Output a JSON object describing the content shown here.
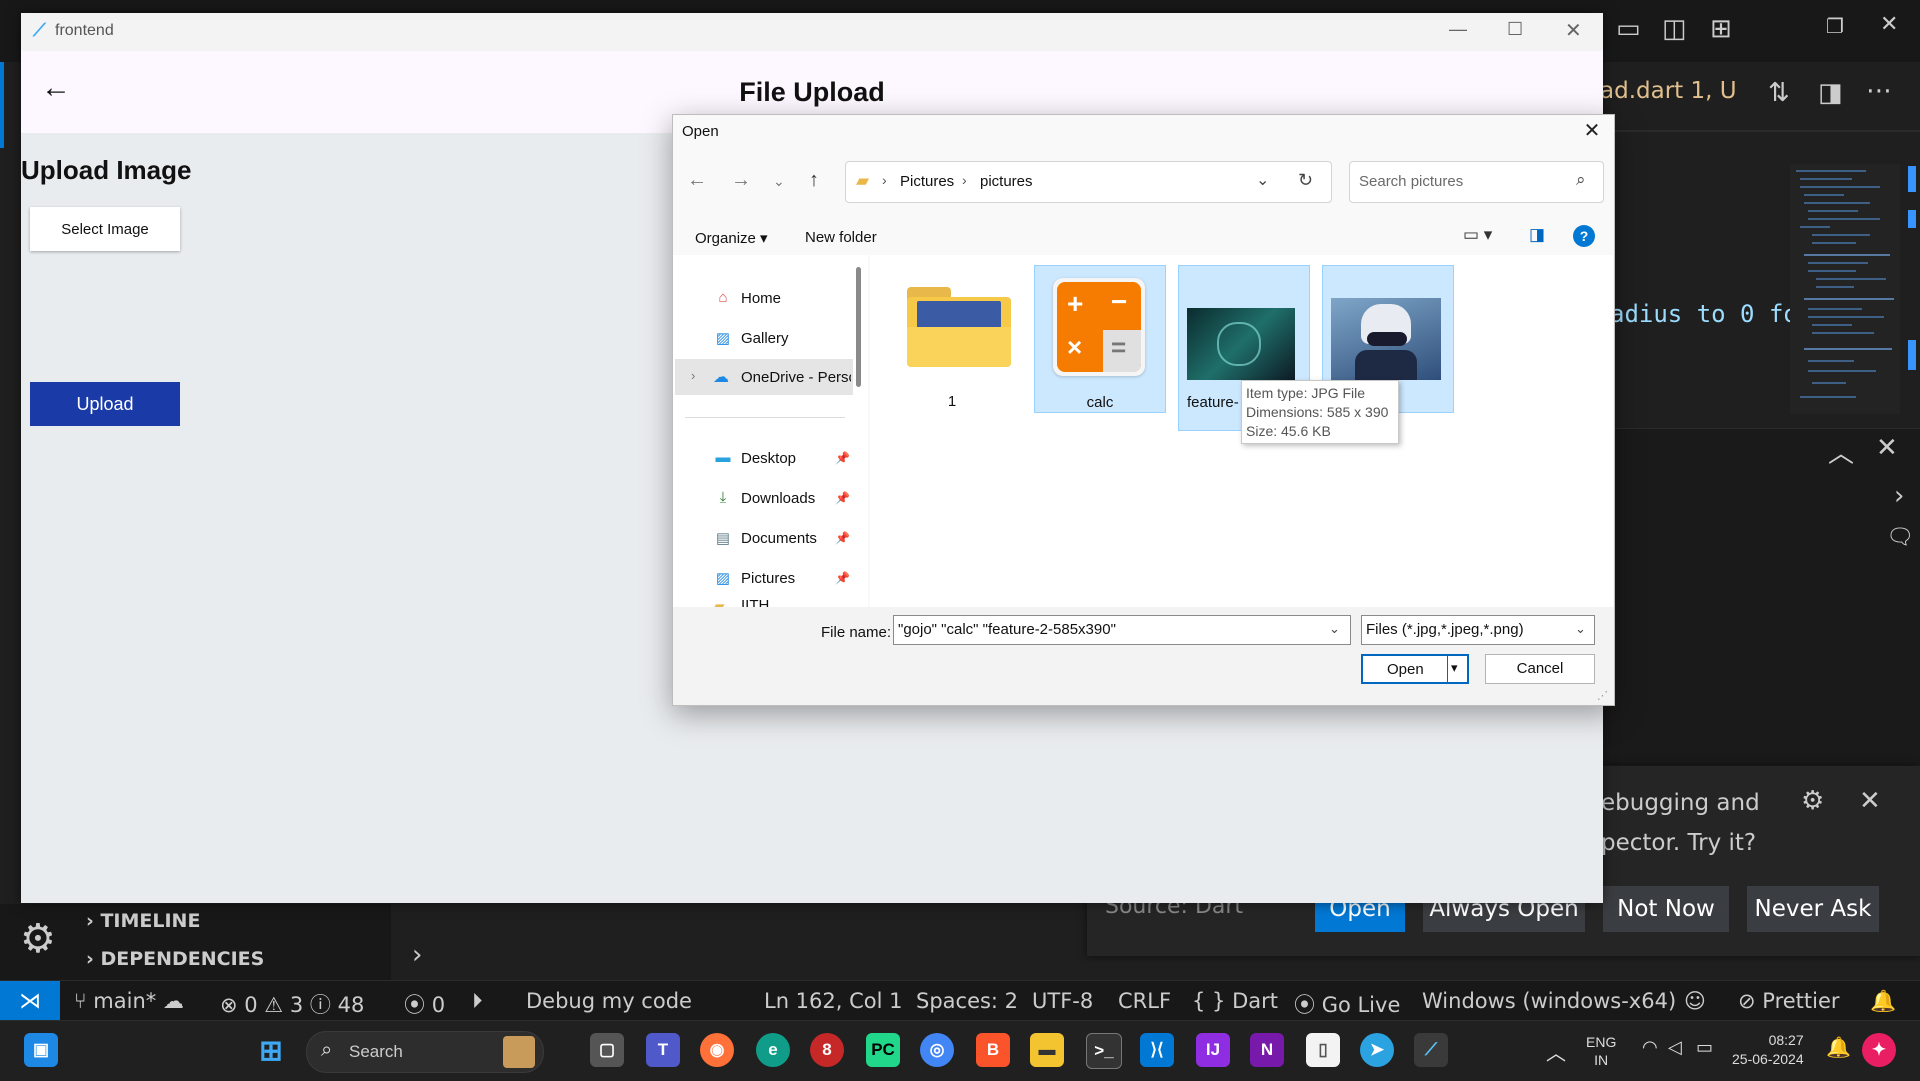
{
  "vscode": {
    "editor_tab": "ad.dart 1, U",
    "code_snippet": "adius to 0 fo",
    "sidebar_sections": [
      "TIMELINE",
      "DEPENDENCIES"
    ],
    "notification": {
      "line1": "ebugging and",
      "line2": "pector. Try it?",
      "source": "Source: Dart",
      "buttons": [
        "Open",
        "Always Open",
        "Not Now",
        "Never Ask"
      ]
    }
  },
  "statusbar": {
    "branch": "main*",
    "errors": "0",
    "warnings": "3",
    "infos": "48",
    "ports": "0",
    "debug": "Debug my code",
    "position": "Ln 162, Col 1",
    "spaces": "Spaces: 2",
    "encoding": "UTF-8",
    "eol": "CRLF",
    "language": "Dart",
    "golive": "Go Live",
    "device": "Windows (windows-x64)",
    "prettier": "Prettier"
  },
  "taskbar": {
    "search_placeholder": "Search",
    "lang_line1": "ENG",
    "lang_line2": "IN",
    "time": "08:27",
    "date": "25-06-2024"
  },
  "app": {
    "window_title": "frontend",
    "appbar_title": "File Upload",
    "heading": "Upload Image",
    "select_button": "Select Image",
    "upload_button": "Upload"
  },
  "dialog": {
    "title": "Open",
    "breadcrumb": [
      "Pictures",
      "pictures"
    ],
    "search_placeholder": "Search pictures",
    "organize": "Organize",
    "new_folder": "New folder",
    "nav_items": [
      {
        "label": "Home",
        "icon": "home-icon",
        "pinned": false
      },
      {
        "label": "Gallery",
        "icon": "gallery-icon",
        "pinned": false
      },
      {
        "label": "OneDrive - Perso",
        "icon": "cloud-icon",
        "pinned": false
      },
      {
        "label": "Desktop",
        "icon": "desktop-icon",
        "pinned": true
      },
      {
        "label": "Downloads",
        "icon": "download-icon",
        "pinned": true
      },
      {
        "label": "Documents",
        "icon": "document-icon",
        "pinned": true
      },
      {
        "label": "Pictures",
        "icon": "pictures-icon",
        "pinned": true
      },
      {
        "label": "IITH",
        "icon": "folder-icon",
        "pinned": true
      }
    ],
    "files": [
      {
        "name": "1",
        "type": "folder",
        "selected": false
      },
      {
        "name": "calc",
        "type": "image",
        "selected": true
      },
      {
        "name": "feature-",
        "type": "image",
        "selected": true
      },
      {
        "name": "o",
        "type": "image",
        "selected": true
      }
    ],
    "tooltip": {
      "line1": "Item type: JPG File",
      "line2": "Dimensions: 585 x 390",
      "line3": "Size: 45.6 KB"
    },
    "filename_label": "File name:",
    "filename_value": "\"gojo\" \"calc\" \"feature-2-585x390\"",
    "filetype_value": "Files (*.jpg,*.jpeg,*.png)",
    "open_button": "Open",
    "cancel_button": "Cancel"
  },
  "colors": {
    "accent_blue": "#0078d4",
    "upload_button": "#1a3aa8",
    "selection": "#cce8ff"
  }
}
